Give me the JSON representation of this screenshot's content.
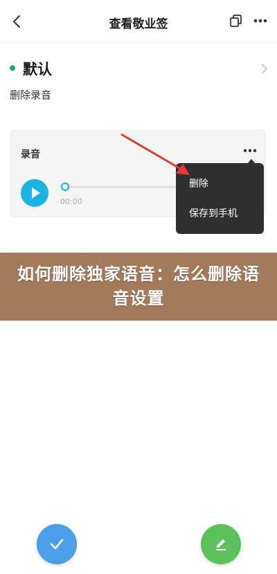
{
  "header": {
    "title": "查看敬业签",
    "icons": {
      "back": "back-icon",
      "copy": "copy-icon",
      "more": "more-icon"
    }
  },
  "note": {
    "title": "默认",
    "body": "删除录音",
    "status_color": "#1aad6a"
  },
  "recording": {
    "label": "录音",
    "time": "00:00",
    "progress": 0
  },
  "menu": {
    "items": [
      "删除",
      "保存到手机"
    ]
  },
  "banner": {
    "text": "如何删除独家语音：怎么删除语音设置"
  },
  "colors": {
    "accent_blue": "#19b4e3",
    "banner": "#a47a5c",
    "confirm": "#4a9fe6",
    "edit": "#5cc05c",
    "arrow": "#e53935"
  }
}
